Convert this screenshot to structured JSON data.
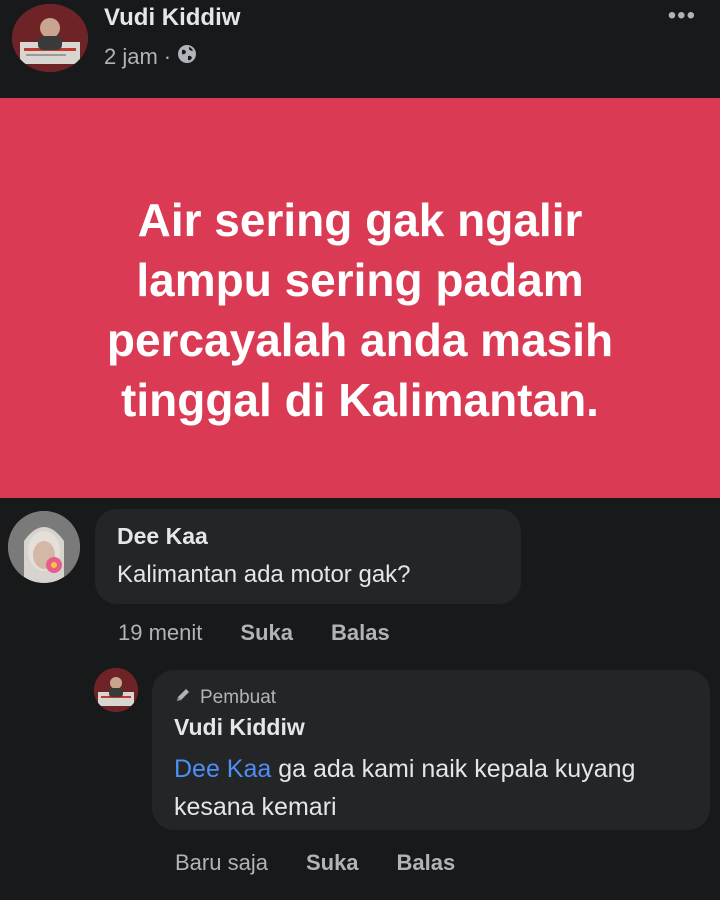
{
  "post": {
    "author": "Vudi Kiddiw",
    "time": "2 jam",
    "separator": "·",
    "visibility_icon": "globe-icon",
    "more_icon": "more-options-icon",
    "more_glyph": "•••"
  },
  "banner": {
    "background": "#db3a55",
    "lines": [
      "Air sering gak ngalir",
      "lampu sering padam",
      "percayalah anda masih",
      "tinggal di Kalimantan."
    ]
  },
  "comment": {
    "author": "Dee Kaa",
    "text": "Kalimantan ada motor gak?",
    "time": "19 menit",
    "like_label": "Suka",
    "reply_label": "Balas"
  },
  "reply": {
    "badge": "Pembuat",
    "badge_icon": "pencil-icon",
    "author": "Vudi Kiddiw",
    "mention": "Dee Kaa",
    "text": " ga ada kami naik kepala kuyang kesana kemari",
    "time": "Baru saja",
    "like_label": "Suka",
    "reply_label": "Balas",
    "mention_color": "#4e8ef7"
  }
}
